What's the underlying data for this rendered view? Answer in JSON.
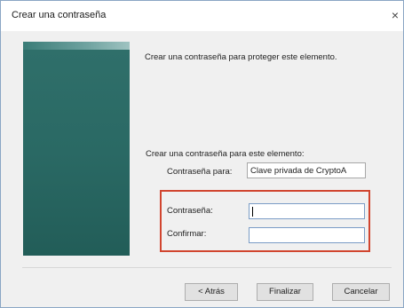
{
  "window": {
    "title": "Crear una contraseña",
    "close_glyph": "×"
  },
  "content": {
    "heading": "Crear una contraseña para proteger este elemento.",
    "subheading": "Crear una contraseña para este elemento:",
    "for_label": "Contraseña para:",
    "for_value": "Clave privada de CryptoA"
  },
  "fields": {
    "password_label": "Contraseña:",
    "password_value": "",
    "confirm_label": "Confirmar:",
    "confirm_value": ""
  },
  "buttons": {
    "back": "< Atrás",
    "finish": "Finalizar",
    "cancel": "Cancelar"
  },
  "colors": {
    "banner": "#2a6964",
    "highlight_border": "#d1452f"
  }
}
